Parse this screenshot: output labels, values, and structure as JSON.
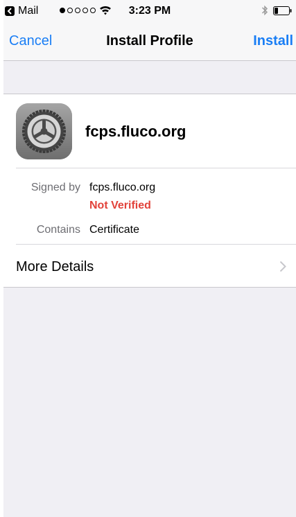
{
  "status_bar": {
    "back_app_label": "Mail",
    "time": "3:23 PM",
    "signal_filled": 1,
    "signal_total": 5,
    "wifi_icon": "wifi-icon",
    "bluetooth_icon": "bluetooth-icon",
    "battery_level": 0.25
  },
  "nav": {
    "cancel_label": "Cancel",
    "title": "Install Profile",
    "install_label": "Install"
  },
  "profile": {
    "icon": "settings-gear-icon",
    "name": "fcps.fluco.org",
    "signed_by_label": "Signed by",
    "signed_by_value": "fcps.fluco.org",
    "verification_status": "Not Verified",
    "contains_label": "Contains",
    "contains_value": "Certificate",
    "more_details_label": "More Details",
    "more_details_icon": "chevron-right-icon"
  },
  "colors": {
    "accent": "#1a7ef5",
    "warning": "#e2423a",
    "background": "#f0eff4"
  }
}
